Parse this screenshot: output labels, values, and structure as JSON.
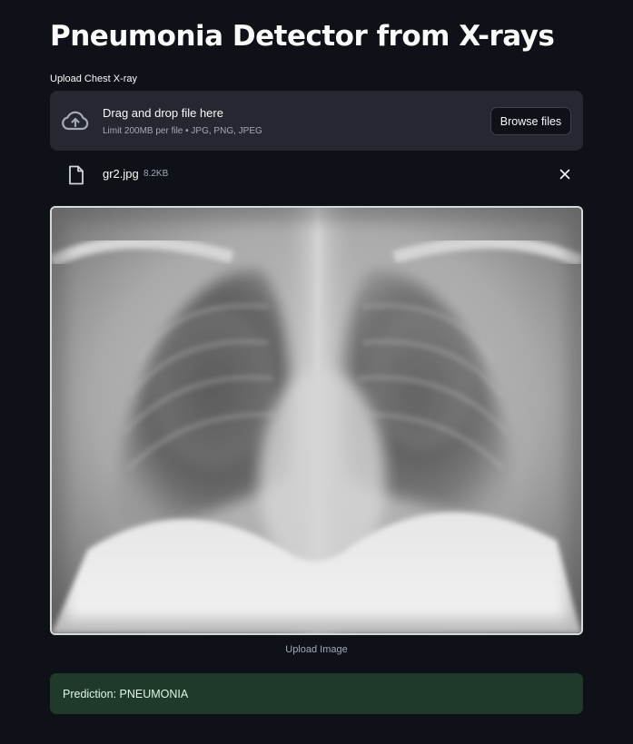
{
  "page": {
    "title": "Pneumonia Detector from X-rays"
  },
  "uploader": {
    "label": "Upload Chest X-ray",
    "drop_title": "Drag and drop file here",
    "drop_subtitle": "Limit 200MB per file • JPG, PNG, JPEG",
    "browse_label": "Browse files",
    "icon": "cloud-upload-icon"
  },
  "uploaded_file": {
    "name": "gr2.jpg",
    "size": "8.2KB",
    "icon": "file-icon"
  },
  "image": {
    "caption": "Upload Image"
  },
  "result": {
    "text": "Prediction: PNEUMONIA",
    "background": "#1f3a2a"
  },
  "colors": {
    "background": "#0e1117",
    "panel": "#262730",
    "text": "#fafafa",
    "muted": "#a3a8b8"
  }
}
